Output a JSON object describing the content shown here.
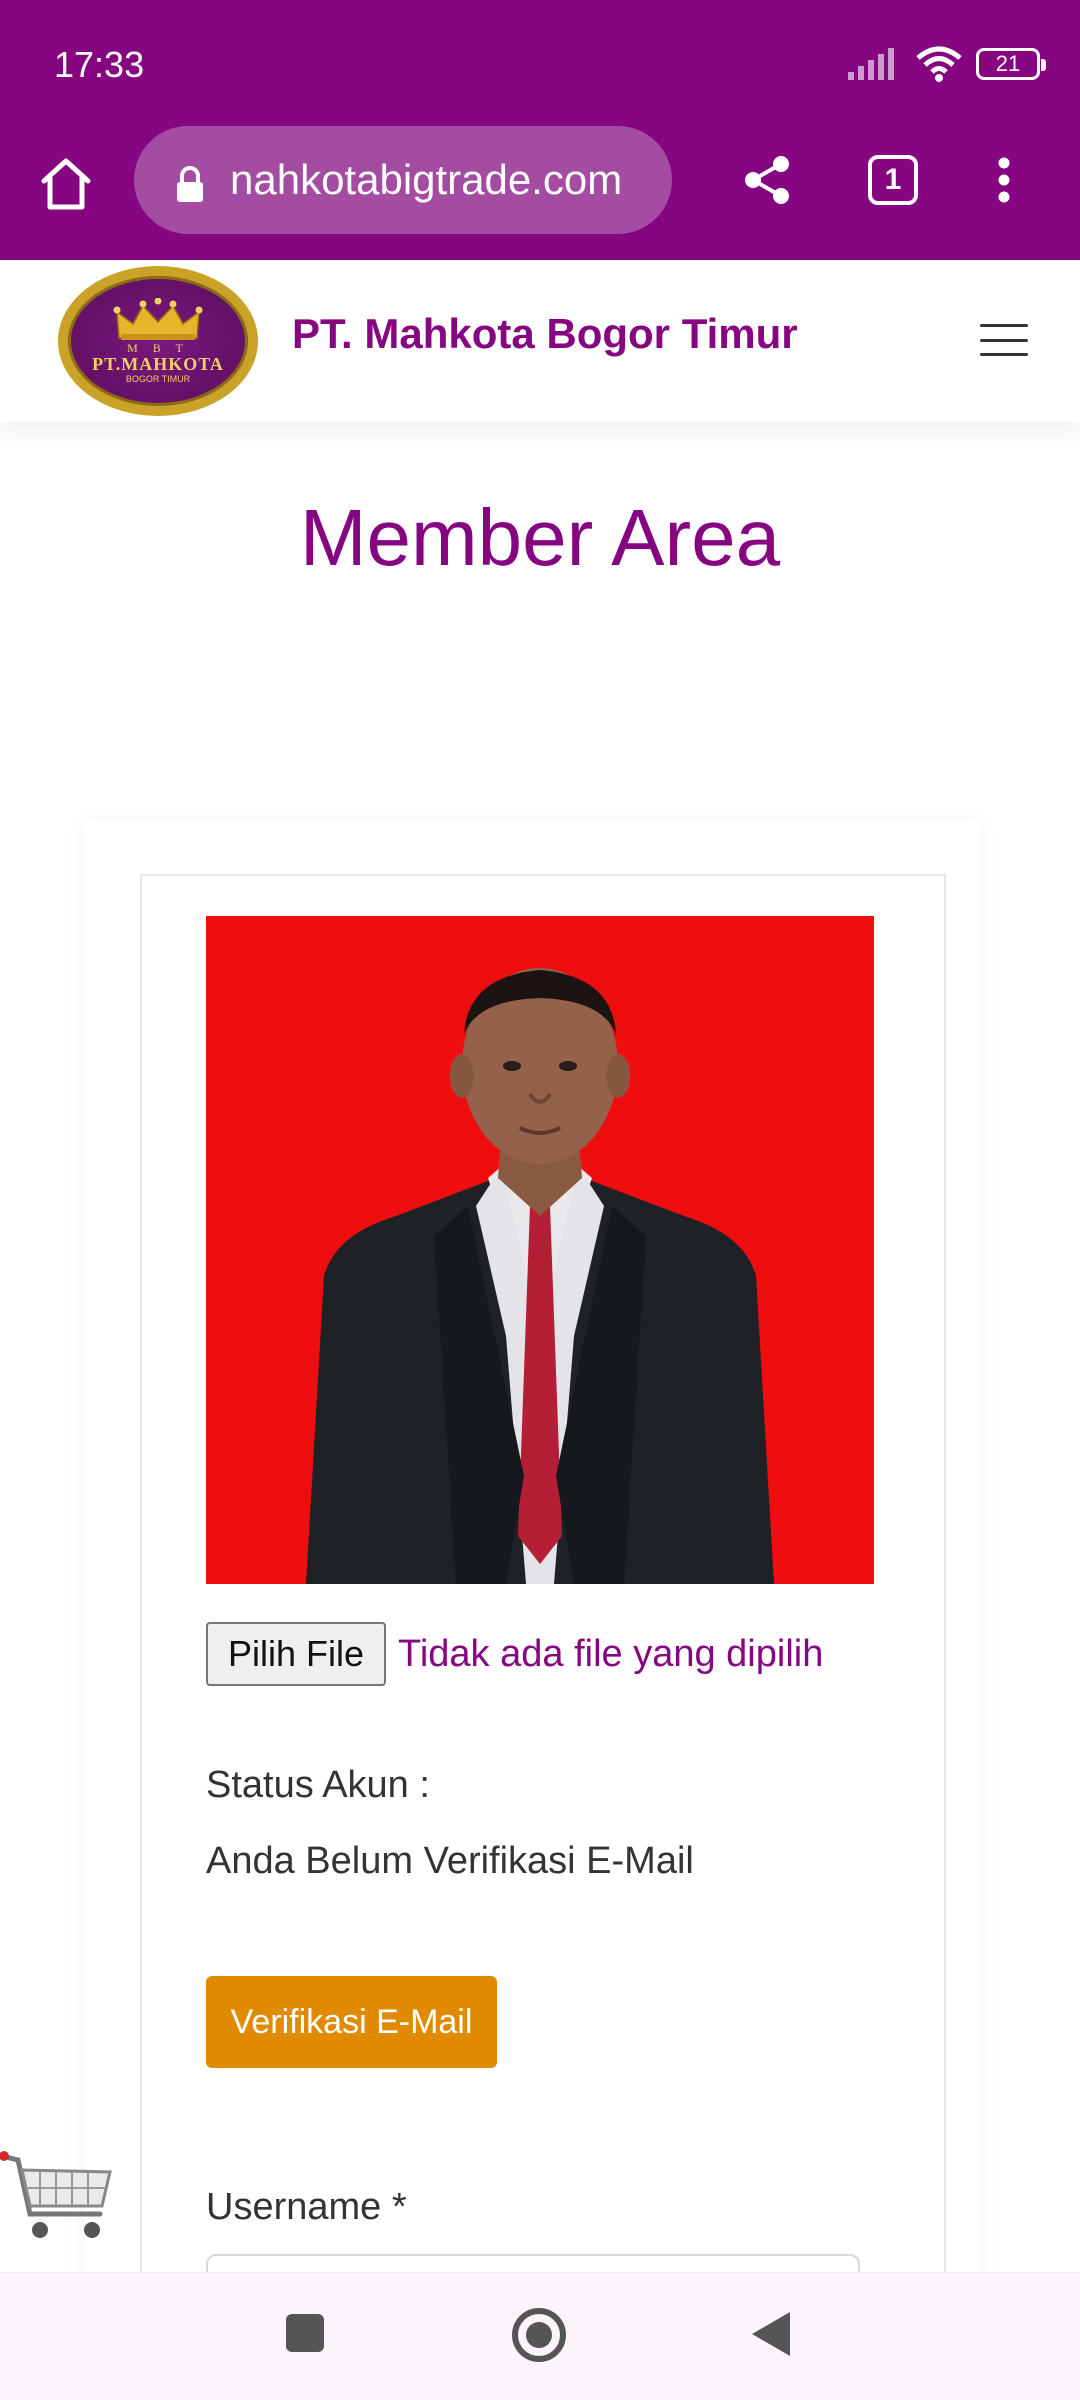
{
  "status_bar": {
    "time": "17:33",
    "battery": "21"
  },
  "browser": {
    "url": "nahkotabigtrade.com",
    "tab_count": "1"
  },
  "site": {
    "brand": "PT. Mahkota Bogor Timur",
    "logo": {
      "top": "M B T",
      "main": "PT.MAHKOTA",
      "sub": "BOGOR TIMUR"
    }
  },
  "page": {
    "title": "Member Area"
  },
  "profile": {
    "file_button": "Pilih File",
    "file_status": "Tidak ada file yang dipilih",
    "status_label": "Status Akun :",
    "status_value": "Anda Belum Verifikasi E-Mail",
    "verify_button": "Verifikasi E-Mail",
    "username_label": "Username *"
  },
  "colors": {
    "brand": "#860581",
    "photo_bg": "#ee0e10",
    "verify": "#e08a00"
  }
}
